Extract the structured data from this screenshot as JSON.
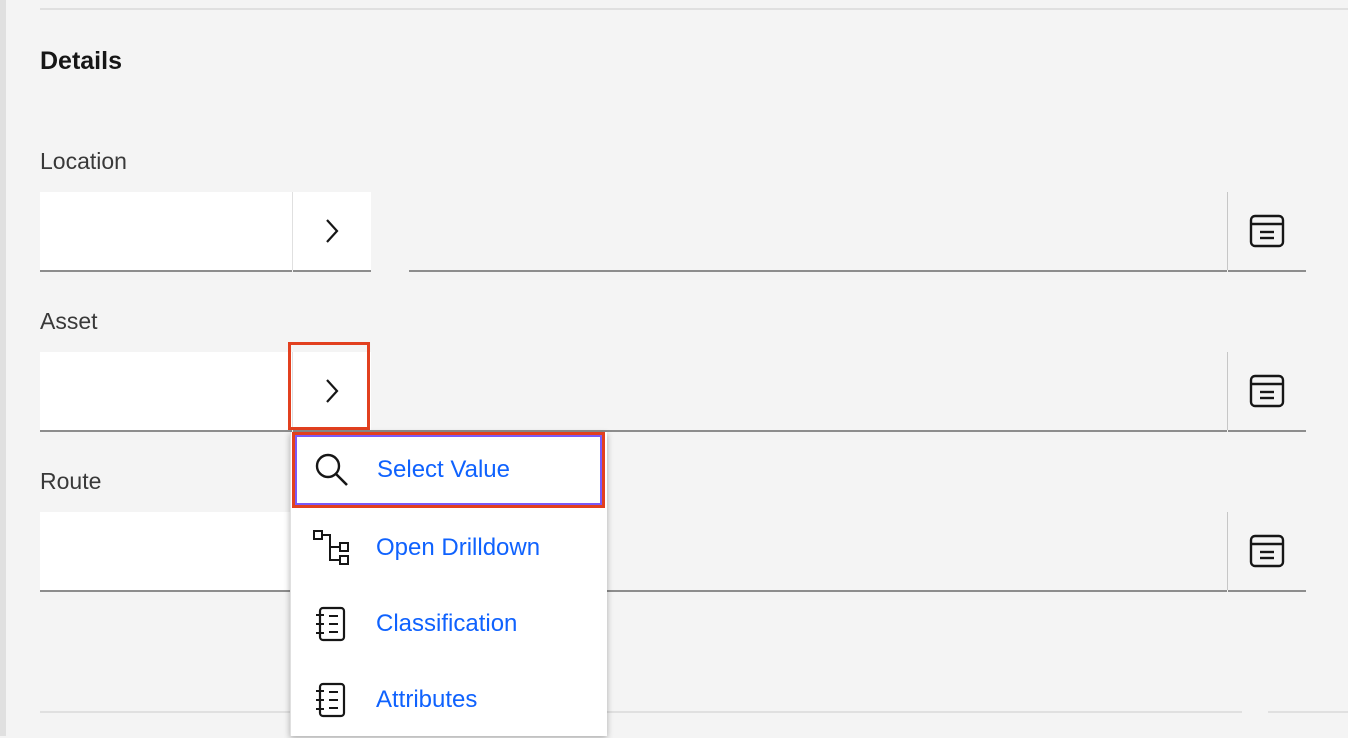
{
  "section": {
    "title": "Details"
  },
  "fields": [
    {
      "label": "Location",
      "value": "",
      "description": ""
    },
    {
      "label": "Asset",
      "value": "",
      "description": ""
    },
    {
      "label": "Route",
      "value": "",
      "description": ""
    }
  ],
  "menu": {
    "items": [
      {
        "label": "Select Value",
        "icon": "search-icon"
      },
      {
        "label": "Open Drilldown",
        "icon": "hierarchy-icon"
      },
      {
        "label": "Classification",
        "icon": "list-book-icon"
      },
      {
        "label": "Attributes",
        "icon": "list-book-icon"
      }
    ]
  },
  "colors": {
    "link": "#0f62fe",
    "highlight": "#e2401f",
    "background": "#f4f4f4"
  }
}
